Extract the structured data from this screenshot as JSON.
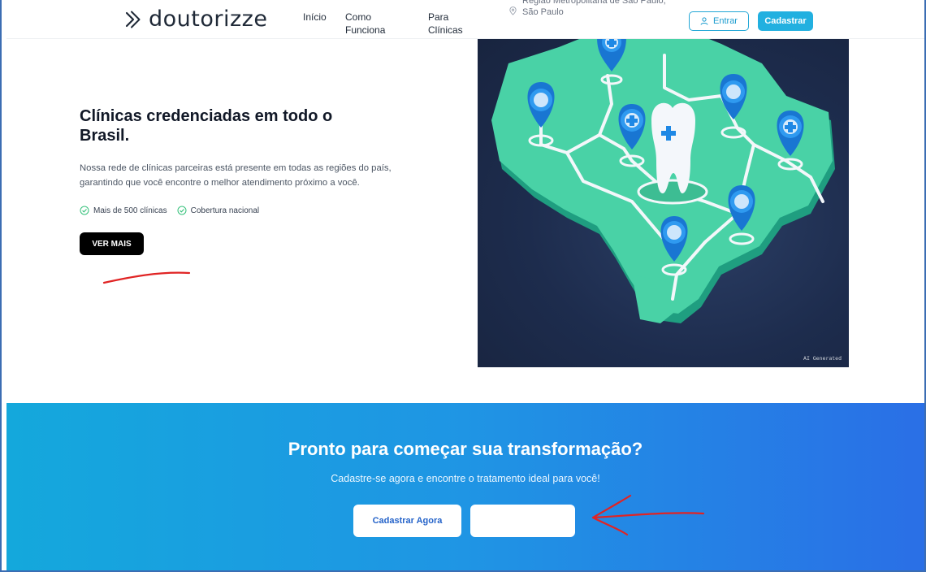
{
  "header": {
    "logo_text": "doutorizze",
    "nav": [
      {
        "label": "Início"
      },
      {
        "label": "Como Funciona"
      },
      {
        "label": "Para Clínicas"
      }
    ],
    "location": "Região Metropolitana de São Paulo, São Paulo",
    "login_label": "Entrar",
    "signup_label": "Cadastrar",
    "accent_color": "#22b0e0"
  },
  "hero": {
    "title": "Clínicas credenciadas em todo o Brasil.",
    "description": "Nossa rede de clínicas parceiras está presente em todas as regiões do país, garantindo que você encontre o melhor atendimento próximo a você.",
    "features": [
      {
        "label": "Mais de 500 clínicas",
        "icon": "check-circle-icon"
      },
      {
        "label": "Cobertura nacional",
        "icon": "check-circle-icon"
      }
    ],
    "button_label": "VER MAIS",
    "image_badge": "AI Generated"
  },
  "cta": {
    "title": "Pronto para começar sua transformação?",
    "subtitle": "Cadastre-se agora e encontre o tratamento ideal para você!",
    "primary_button": "Cadastrar Agora",
    "secondary_button": "",
    "gradient_start": "#14a8dc",
    "gradient_end": "#2a6fe6"
  }
}
